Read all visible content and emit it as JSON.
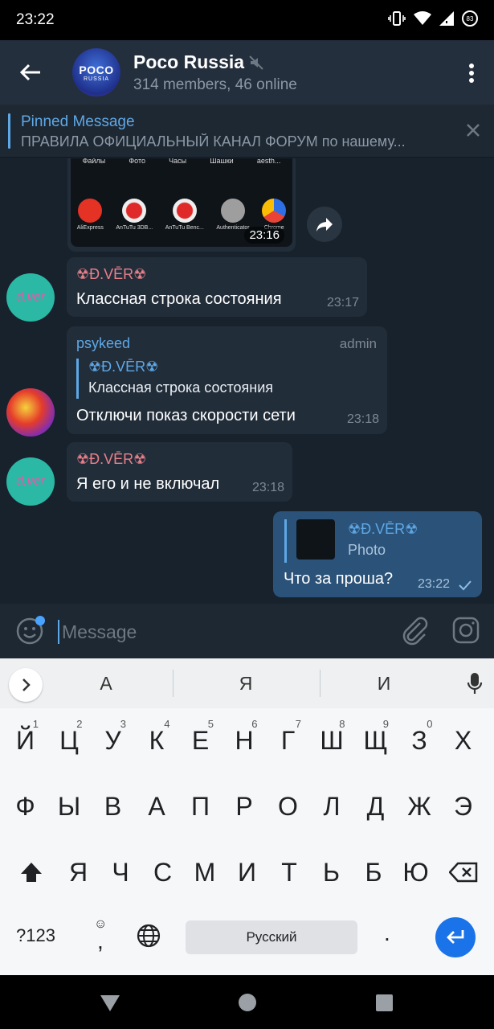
{
  "status_bar": {
    "time": "23:22",
    "battery": "83"
  },
  "header": {
    "avatar_text_1": "POCO",
    "avatar_text_2": "RUSSIA",
    "title": "Poco Russia",
    "subtitle": "314 members, 46 online"
  },
  "pinned": {
    "title": "Pinned Message",
    "text": "ПРАВИЛА ОФИЦИАЛЬНЫЙ КАНАЛ ФОРУМ по нашему..."
  },
  "image_message": {
    "apps_top": [
      "Файлы",
      "Фото",
      "Часы",
      "Шашки",
      "aesth..."
    ],
    "apps": [
      {
        "label": "AliExpress",
        "color": "#e43225"
      },
      {
        "label": "AnTuTu 3DB...",
        "color": "#e8e8e8"
      },
      {
        "label": "AnTuTu Benc...",
        "color": "#e8e8e8"
      },
      {
        "label": "Authenticator",
        "color": "#9e9e9e"
      },
      {
        "label": "Chrome",
        "color": "#ffffff"
      }
    ],
    "time": "23:16"
  },
  "messages": [
    {
      "sender": "☢Đ.VĒR☢",
      "text": "Классная строка состояния",
      "time": "23:17",
      "avatar_text": "d.ver"
    },
    {
      "sender": "psykeed",
      "role": "admin",
      "reply_name": "☢Đ.VĒR☢",
      "reply_text": "Классная строка состояния",
      "text": "Отключи показ скорости сети",
      "time": "23:18"
    },
    {
      "sender": "☢Đ.VĒR☢",
      "text": "Я его и не включал",
      "time": "23:18",
      "avatar_text": "d.ver"
    },
    {
      "reply_name": "☢Đ.VĒR☢",
      "reply_text": "Photo",
      "text": "Что за проша?",
      "time": "23:22"
    }
  ],
  "input": {
    "placeholder": "Message"
  },
  "keyboard": {
    "suggestions": [
      "А",
      "Я",
      "И"
    ],
    "row1": [
      {
        "k": "Й",
        "h": "1"
      },
      {
        "k": "Ц",
        "h": "2"
      },
      {
        "k": "У",
        "h": "3"
      },
      {
        "k": "К",
        "h": "4"
      },
      {
        "k": "Е",
        "h": "5"
      },
      {
        "k": "Н",
        "h": "6"
      },
      {
        "k": "Г",
        "h": "7"
      },
      {
        "k": "Ш",
        "h": "8"
      },
      {
        "k": "Щ",
        "h": "9"
      },
      {
        "k": "З",
        "h": "0"
      },
      {
        "k": "Х",
        "h": ""
      }
    ],
    "row2": [
      "Ф",
      "Ы",
      "В",
      "А",
      "П",
      "Р",
      "О",
      "Л",
      "Д",
      "Ж",
      "Э"
    ],
    "row3": [
      "Я",
      "Ч",
      "С",
      "М",
      "И",
      "Т",
      "Ь",
      "Б",
      "Ю"
    ],
    "symbols_key": "?123",
    "comma_key": ",",
    "space_label": "Русский",
    "period_key": "."
  },
  "colors": {
    "accent": "#5ea8e6",
    "outgoing_bubble": "#2b5278",
    "incoming_bubble": "#222d3a",
    "background": "#18222d",
    "sender_name": "#e8808a"
  }
}
